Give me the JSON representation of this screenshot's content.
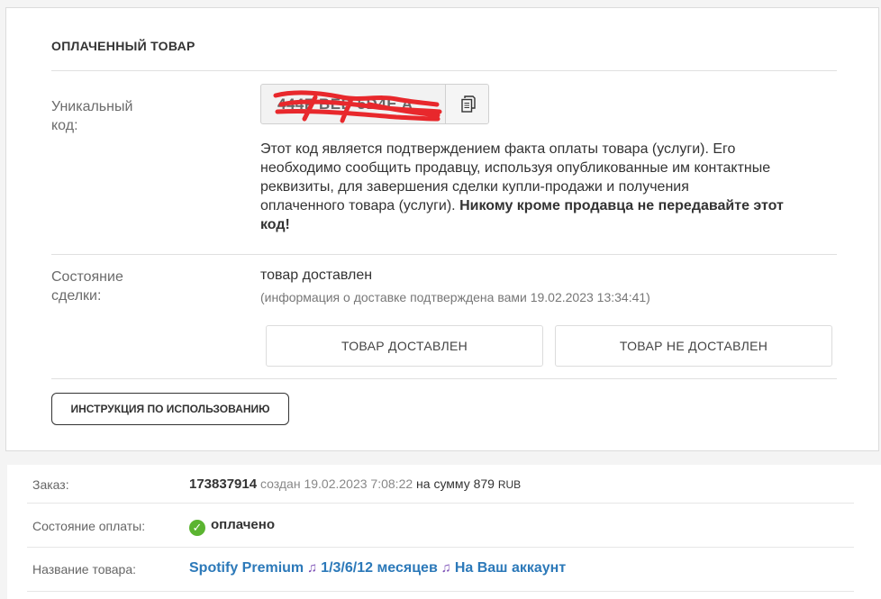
{
  "paid_panel": {
    "title": "ОПЛАЧЕННЫЙ ТОВАР",
    "code_label_1": "Уникальный",
    "code_label_2": "код:",
    "code_value": "444F  BED  5D4E  A",
    "description_1": "Этот код является подтверждением факта оплаты товара (услуги). Его",
    "description_2": "необходимо сообщить продавцу, используя опубликованные им контактные",
    "description_3": "реквизиты, для завершения сделки купли-продажи и получения",
    "description_4": "оплаченного товара (услуги).",
    "description_warning_1": "Никому кроме продавца не передавайте этот",
    "description_warning_2": "код!",
    "deal_label_1": "Состояние",
    "deal_label_2": "сделки:",
    "deal_status": "товар доставлен",
    "deal_note": "(информация о доставке подтверждена вами 19.02.2023 13:34:41)",
    "btn_delivered": "ТОВАР ДОСТАВЛЕН",
    "btn_not_delivered": "ТОВАР НЕ ДОСТАВЛЕН",
    "btn_instructions": "ИНСТРУКЦИЯ ПО ИСПОЛЬЗОВАНИЮ"
  },
  "order": {
    "order_label": "Заказ:",
    "order_id": "173837914",
    "created_word": "создан",
    "created_date": "19.02.2023 7:08:22",
    "sum_word": "на сумму",
    "sum_value": "879",
    "currency": "RUB",
    "payment_label": "Состояние оплаты:",
    "payment_status": "оплачено",
    "product_label": "Название товара:",
    "product_part1": "Spotify Premium",
    "product_part2": "1/3/6/12 месяцев",
    "product_part3": "На Ваш аккаунт"
  },
  "icons": {
    "copy": "copy-icon",
    "check": "check-circle-icon",
    "note": "music-note-icon"
  },
  "colors": {
    "link": "#2c79b9",
    "paid_green": "#5bb431",
    "redaction_red": "#e8282c"
  }
}
